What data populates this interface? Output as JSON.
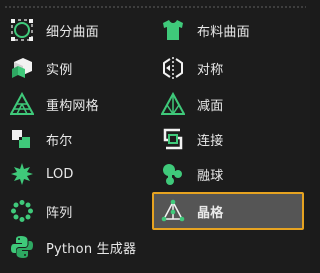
{
  "menu": {
    "left": [
      {
        "label": "细分曲面",
        "icon": "subdivision-surface-icon"
      },
      {
        "label": "实例",
        "icon": "instance-icon"
      },
      {
        "label": "重构网格",
        "icon": "remesh-icon"
      },
      {
        "label": "布尔",
        "icon": "boolean-icon"
      },
      {
        "label": "LOD",
        "icon": "lod-icon"
      },
      {
        "label": "阵列",
        "icon": "array-icon"
      },
      {
        "label": "Python 生成器",
        "icon": "python-generator-icon"
      }
    ],
    "right": [
      {
        "label": "布料曲面",
        "icon": "cloth-surface-icon"
      },
      {
        "label": "对称",
        "icon": "symmetry-icon"
      },
      {
        "label": "减面",
        "icon": "polygon-reduction-icon"
      },
      {
        "label": "连接",
        "icon": "connect-icon"
      },
      {
        "label": "融球",
        "icon": "metaball-icon"
      },
      {
        "label": "晶格",
        "icon": "lattice-icon"
      }
    ],
    "selected": "晶格"
  },
  "colors": {
    "icon_green": "#3fc97a",
    "icon_white": "#f2f2f2",
    "selection_border": "#e6a321",
    "selection_bg": "#555555",
    "background": "#1c1c1c"
  }
}
